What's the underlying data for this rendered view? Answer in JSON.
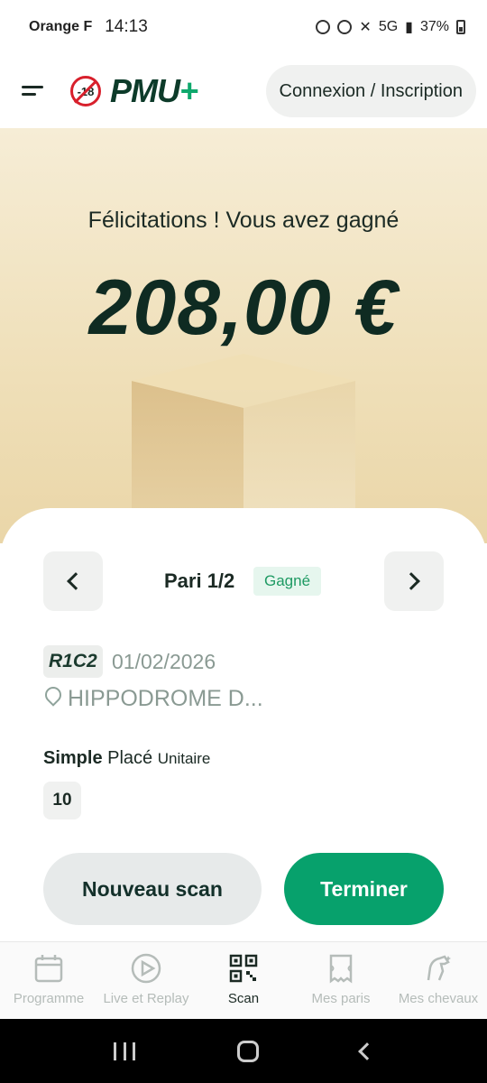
{
  "status_bar": {
    "carrier": "Orange F",
    "time": "14:13",
    "network": "5G",
    "battery": "37%"
  },
  "header": {
    "age_label": "-18",
    "logo_text": "PMU",
    "logo_plus": "+",
    "login_label": "Connexion / Inscription"
  },
  "hero": {
    "congrats": "Félicitations ! Vous avez gagné",
    "amount": "208,00 €"
  },
  "bet": {
    "title": "Pari 1/2",
    "status": "Gagné",
    "race_code": "R1C2",
    "date": "01/02/2026",
    "venue": "HIPPODROME D...",
    "type_bold": "Simple",
    "type_name": "Placé",
    "type_unit": "Unitaire",
    "horse_number": "10"
  },
  "actions": {
    "new_scan": "Nouveau scan",
    "finish": "Terminer"
  },
  "bottom_nav": {
    "items": [
      {
        "label": "Programme",
        "icon": "calendar-icon"
      },
      {
        "label": "Live et Replay",
        "icon": "play-icon"
      },
      {
        "label": "Scan",
        "icon": "qr-code-icon"
      },
      {
        "label": "Mes paris",
        "icon": "ticket-icon"
      },
      {
        "label": "Mes chevaux",
        "icon": "horse-icon"
      }
    ]
  },
  "colors": {
    "brand_green": "#07a16c",
    "dark_text": "#1b2a24",
    "badge_green": "#1e9a63"
  }
}
